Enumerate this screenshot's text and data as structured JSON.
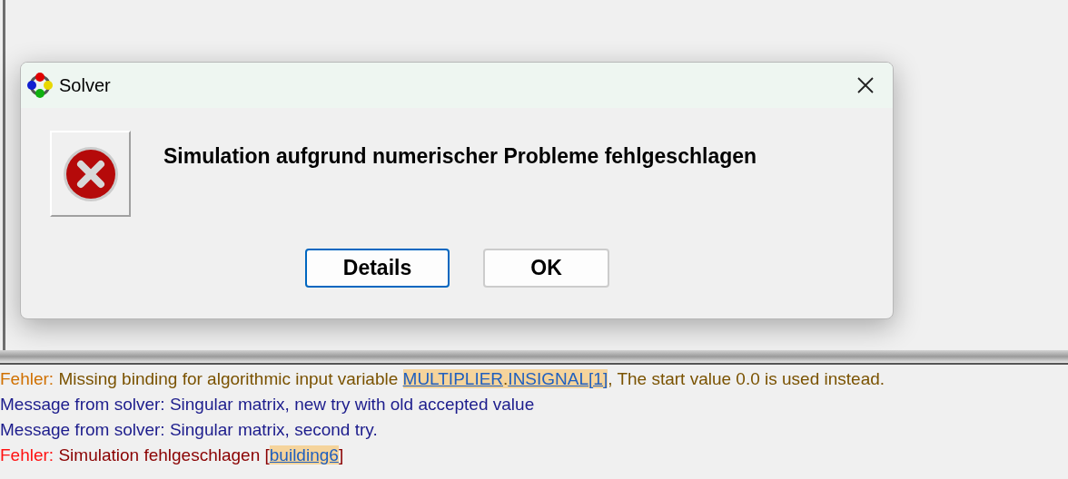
{
  "dialog": {
    "title": "Solver",
    "message": "Simulation aufgrund numerischer Probleme fehlgeschlagen",
    "buttons": [
      {
        "label": "Details",
        "selected": true
      },
      {
        "label": "OK",
        "selected": false
      }
    ]
  },
  "log": [
    {
      "kind": "warning",
      "segments": [
        {
          "kind": "prefix",
          "text": "Fehler:"
        },
        {
          "kind": "text",
          "text": " Missing binding for algorithmic input variable "
        },
        {
          "kind": "link",
          "text": "MULTIPLIER"
        },
        {
          "kind": "hl",
          "text": "."
        },
        {
          "kind": "link",
          "text": "INSIGNAL[1]"
        },
        {
          "kind": "text",
          "text": ", The start value 0.0 is used instead."
        }
      ]
    },
    {
      "kind": "info",
      "segments": [
        {
          "kind": "text",
          "text": "Message from solver: Singular matrix, new try with old accepted value"
        }
      ]
    },
    {
      "kind": "info",
      "segments": [
        {
          "kind": "text",
          "text": "Message from solver: Singular matrix, second try."
        }
      ]
    },
    {
      "kind": "error",
      "segments": [
        {
          "kind": "prefix",
          "text": "Fehler:"
        },
        {
          "kind": "text",
          "text": " Simulation fehlgeschlagen ["
        },
        {
          "kind": "link",
          "text": "building6"
        },
        {
          "kind": "text",
          "text": "]"
        }
      ]
    }
  ]
}
